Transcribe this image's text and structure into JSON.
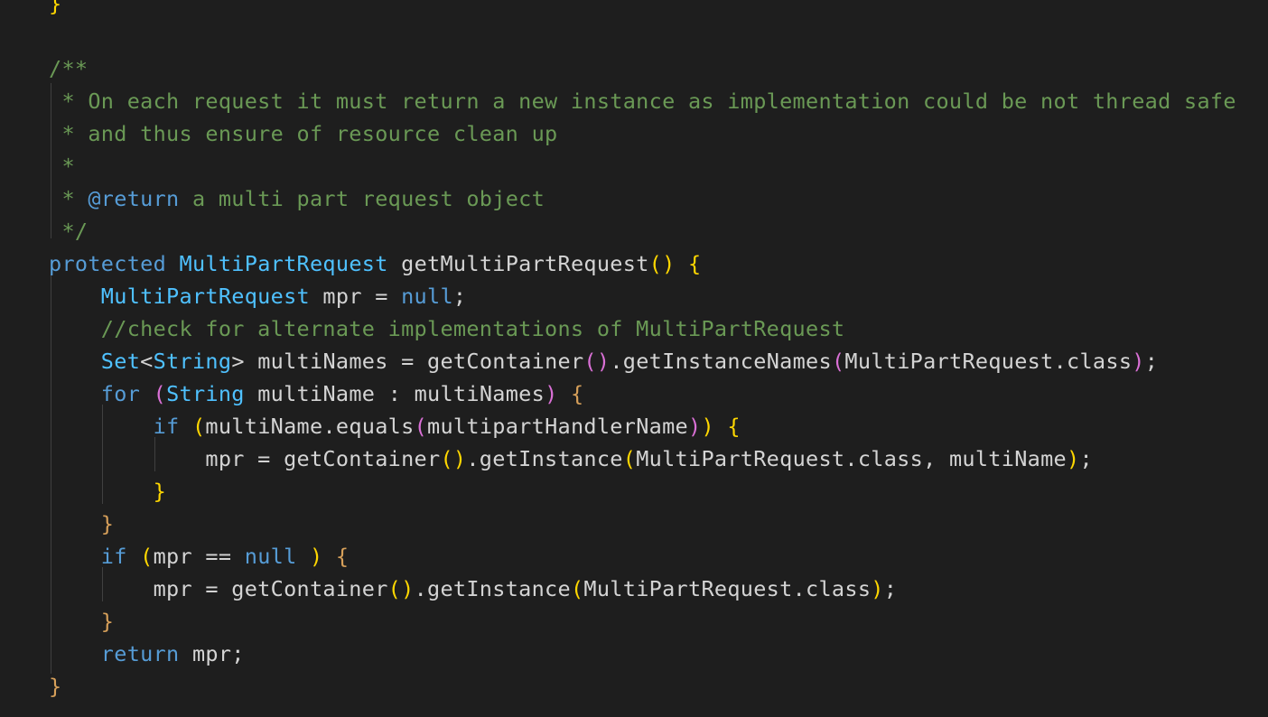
{
  "editor": {
    "language": "java",
    "theme_colors": {
      "background": "#1e1e1e",
      "comment": "#6a9955",
      "keyword": "#569cd6",
      "identifier": "#d4d4d4",
      "bracket_gold": "#ffd700",
      "bracket_magenta": "#da70d6",
      "bracket_brown": "#d7a05a"
    },
    "lines": [
      {
        "tokens": [
          {
            "t": "}",
            "c": "b1"
          }
        ]
      },
      {
        "tokens": []
      },
      {
        "tokens": [
          {
            "t": "/**",
            "c": "c-comment"
          }
        ]
      },
      {
        "tokens": [
          {
            "t": " * On each request it must return a new instance as implementation could be not thread safe",
            "c": "c-comment"
          }
        ]
      },
      {
        "tokens": [
          {
            "t": " * and thus ensure of resource clean up",
            "c": "c-comment"
          }
        ]
      },
      {
        "tokens": [
          {
            "t": " *",
            "c": "c-comment"
          }
        ]
      },
      {
        "tokens": [
          {
            "t": " * ",
            "c": "c-comment"
          },
          {
            "t": "@return",
            "c": "c-tag"
          },
          {
            "t": " a multi part request object",
            "c": "c-comment"
          }
        ]
      },
      {
        "tokens": [
          {
            "t": " */",
            "c": "c-comment"
          }
        ]
      },
      {
        "tokens": [
          {
            "t": "protected",
            "c": "c-kw"
          },
          {
            "t": " ",
            "c": "c-id"
          },
          {
            "t": "MultiPartRequest",
            "c": "c-type2"
          },
          {
            "t": " ",
            "c": "c-id"
          },
          {
            "t": "getMultiPartRequest",
            "c": "c-id"
          },
          {
            "t": "()",
            "c": "b1"
          },
          {
            "t": " ",
            "c": "c-id"
          },
          {
            "t": "{",
            "c": "b1"
          }
        ]
      },
      {
        "tokens": [
          {
            "t": "    ",
            "c": "c-id"
          },
          {
            "t": "MultiPartRequest",
            "c": "c-type2"
          },
          {
            "t": " mpr = ",
            "c": "c-id"
          },
          {
            "t": "null",
            "c": "c-kw"
          },
          {
            "t": ";",
            "c": "c-id"
          }
        ]
      },
      {
        "tokens": [
          {
            "t": "    ",
            "c": "c-id"
          },
          {
            "t": "//check for alternate implementations of MultiPartRequest",
            "c": "c-comment"
          }
        ]
      },
      {
        "tokens": [
          {
            "t": "    ",
            "c": "c-id"
          },
          {
            "t": "Set",
            "c": "c-type2"
          },
          {
            "t": "<",
            "c": "c-id"
          },
          {
            "t": "String",
            "c": "c-type2"
          },
          {
            "t": "> multiNames = getContainer",
            "c": "c-id"
          },
          {
            "t": "()",
            "c": "b2"
          },
          {
            "t": ".getInstanceNames",
            "c": "c-id"
          },
          {
            "t": "(",
            "c": "b2"
          },
          {
            "t": "MultiPartRequest.class",
            "c": "c-id"
          },
          {
            "t": ")",
            "c": "b2"
          },
          {
            "t": ";",
            "c": "c-id"
          }
        ]
      },
      {
        "tokens": [
          {
            "t": "    ",
            "c": "c-id"
          },
          {
            "t": "for",
            "c": "c-kw"
          },
          {
            "t": " ",
            "c": "c-id"
          },
          {
            "t": "(",
            "c": "b2"
          },
          {
            "t": "String",
            "c": "c-type2"
          },
          {
            "t": " multiName : multiNames",
            "c": "c-id"
          },
          {
            "t": ")",
            "c": "b2"
          },
          {
            "t": " ",
            "c": "c-id"
          },
          {
            "t": "{",
            "c": "b-brown"
          }
        ]
      },
      {
        "tokens": [
          {
            "t": "        ",
            "c": "c-id"
          },
          {
            "t": "if",
            "c": "c-kw"
          },
          {
            "t": " ",
            "c": "c-id"
          },
          {
            "t": "(",
            "c": "b1"
          },
          {
            "t": "multiName.equals",
            "c": "c-id"
          },
          {
            "t": "(",
            "c": "b2"
          },
          {
            "t": "multipartHandlerName",
            "c": "c-id"
          },
          {
            "t": ")",
            "c": "b2"
          },
          {
            "t": ")",
            "c": "b1"
          },
          {
            "t": " ",
            "c": "c-id"
          },
          {
            "t": "{",
            "c": "b1"
          }
        ]
      },
      {
        "tokens": [
          {
            "t": "            mpr = getContainer",
            "c": "c-id"
          },
          {
            "t": "()",
            "c": "b1"
          },
          {
            "t": ".getInstance",
            "c": "c-id"
          },
          {
            "t": "(",
            "c": "b1"
          },
          {
            "t": "MultiPartRequest.class, multiName",
            "c": "c-id"
          },
          {
            "t": ")",
            "c": "b1"
          },
          {
            "t": ";",
            "c": "c-id"
          }
        ]
      },
      {
        "tokens": [
          {
            "t": "        ",
            "c": "c-id"
          },
          {
            "t": "}",
            "c": "b1"
          }
        ]
      },
      {
        "tokens": [
          {
            "t": "    ",
            "c": "c-id"
          },
          {
            "t": "}",
            "c": "b-brown"
          }
        ]
      },
      {
        "tokens": [
          {
            "t": "    ",
            "c": "c-id"
          },
          {
            "t": "if",
            "c": "c-kw"
          },
          {
            "t": " ",
            "c": "c-id"
          },
          {
            "t": "(",
            "c": "b1"
          },
          {
            "t": "mpr == ",
            "c": "c-id"
          },
          {
            "t": "null",
            "c": "c-kw"
          },
          {
            "t": " ",
            "c": "c-id"
          },
          {
            "t": ")",
            "c": "b1"
          },
          {
            "t": " ",
            "c": "c-id"
          },
          {
            "t": "{",
            "c": "b-brown"
          }
        ]
      },
      {
        "tokens": [
          {
            "t": "        mpr = getContainer",
            "c": "c-id"
          },
          {
            "t": "()",
            "c": "b1"
          },
          {
            "t": ".getInstance",
            "c": "c-id"
          },
          {
            "t": "(",
            "c": "b1"
          },
          {
            "t": "MultiPartRequest.class",
            "c": "c-id"
          },
          {
            "t": ")",
            "c": "b1"
          },
          {
            "t": ";",
            "c": "c-id"
          }
        ]
      },
      {
        "tokens": [
          {
            "t": "    ",
            "c": "c-id"
          },
          {
            "t": "}",
            "c": "b-brown"
          }
        ]
      },
      {
        "tokens": [
          {
            "t": "    ",
            "c": "c-id"
          },
          {
            "t": "return",
            "c": "c-kw"
          },
          {
            "t": " mpr;",
            "c": "c-id"
          }
        ]
      },
      {
        "tokens": [
          {
            "t": "}",
            "c": "b-brown"
          }
        ]
      }
    ]
  }
}
